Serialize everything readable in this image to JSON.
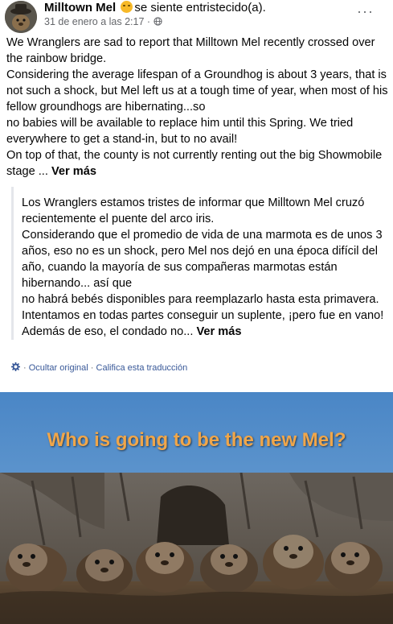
{
  "post": {
    "author": "Milltown Mel",
    "feeling": "se siente entristecido(a).",
    "feeling_icon": "sad-face-emoji",
    "timestamp": "31 de enero a las 2:17",
    "separator": "·",
    "privacy_icon": "globe-icon",
    "more_icon": "ellipsis-icon",
    "more_label": "···",
    "text_lines": [
      "We Wranglers are sad to report that Milltown Mel recently crossed over the rainbow bridge.",
      "Considering the average lifespan of a Groundhog is about 3 years, that is not such a shock, but Mel left us at a tough time of year, when most of his fellow groundhogs are hibernating...so",
      "no babies will be available to replace him until this Spring.  We tried everywhere to get a stand-in, but to no avail!",
      "On top of that, the county is not currently renting out the big Showmobile stage ..."
    ],
    "see_more": "Ver más"
  },
  "translation": {
    "lines": [
      "Los Wranglers estamos tristes de informar que Milltown Mel cruzó recientemente el puente del arco iris.",
      "Considerando que el promedio de vida de una marmota es de unos 3 años, eso no es un shock, pero Mel nos dejó en una época difícil del año, cuando la mayoría de sus compañeras marmotas están hibernando... así que",
      "no habrá bebés disponibles para reemplazarlo hasta esta primavera. Intentamos en todas partes conseguir un suplente, ¡pero fue en vano!",
      "Además de eso, el condado no..."
    ],
    "see_more": "Ver más",
    "hide_original": "Ocultar original",
    "separator": "·",
    "rate": "Califica esta traducción",
    "gear_icon": "gear-icon"
  },
  "image": {
    "headline": "Who is going to be the new Mel?",
    "sky_color": "#4a86c6",
    "headline_color": "#f0a64a"
  }
}
